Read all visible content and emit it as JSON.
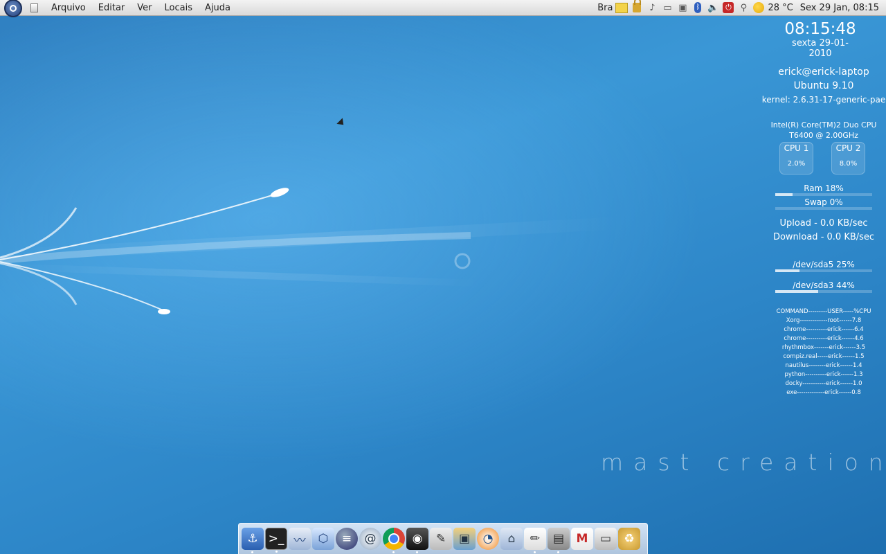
{
  "top_panel": {
    "menu": [
      "Arquivo",
      "Editar",
      "Ver",
      "Locais",
      "Ajuda"
    ],
    "keyboard_layout": "Bra",
    "weather": "28 °C",
    "datetime": "Sex 29 Jan, 08:15"
  },
  "conky": {
    "time": "08:15:48",
    "date": "sexta 29-01-2010",
    "user": "erick@erick-laptop",
    "os": "Ubuntu 9.10",
    "kernel": "kernel: 2.6.31-17-generic-pae",
    "cpu_model_line1": "Intel(R) Core(TM)2 Duo CPU",
    "cpu_model_line2": "T6400  @ 2.00GHz",
    "cpu1": {
      "name": "CPU 1",
      "usage": "2.0%"
    },
    "cpu2": {
      "name": "CPU 2",
      "usage": "8.0%"
    },
    "ram": {
      "label": "Ram 18%",
      "level": 0.18
    },
    "swap": {
      "label": "Swap 0%",
      "level": 0.0
    },
    "upload": "Upload - 0.0 KB/sec",
    "download": "Download - 0.0 KB/sec",
    "disk1": {
      "label": "/dev/sda5 25%",
      "level": 0.25
    },
    "disk2": {
      "label": "/dev/sda3 44%",
      "level": 0.44
    },
    "processes": [
      "COMMAND---------USER-----%CPU",
      "Xorg-------------root------7.8",
      "chrome----------erick------6.4",
      "chrome----------erick------4.6",
      "rhythmbox-------erick------3.5",
      "compiz.real-----erick------1.5",
      "nautilus--------erick------1.4",
      "python----------erick------1.3",
      "docky-----------erick------1.0",
      "exe-------------erick------0.8"
    ]
  },
  "watermark": "mast creation",
  "colors": {
    "panel": "#e6e6e6",
    "desktop": "#3a97d6"
  }
}
